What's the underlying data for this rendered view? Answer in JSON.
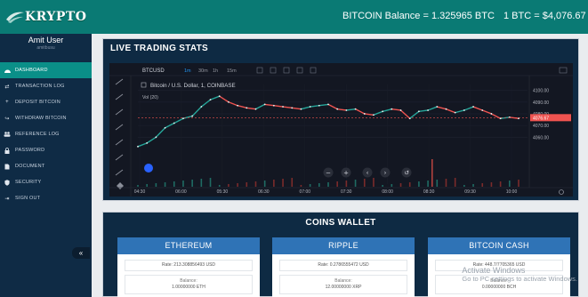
{
  "topbar": {
    "logo_text": "KRYPTO",
    "btc_balance": "BITCOIN Balance = 1.325965 BTC",
    "btc_rate": "1 BTC = $4,076.67"
  },
  "user": {
    "name": "Amit User",
    "id": "amitbusu"
  },
  "sidebar": {
    "items": [
      {
        "label": "DASHBOARD",
        "icon": "dashboard-icon"
      },
      {
        "label": "TRANSACTION LOG",
        "icon": "exchange-icon"
      },
      {
        "label": "DEPOSIT BITCOIN",
        "icon": "plus-icon"
      },
      {
        "label": "WITHDRAW BITCOIN",
        "icon": "share-icon"
      },
      {
        "label": "REFERENCE LOG",
        "icon": "users-icon"
      },
      {
        "label": "PASSWORD",
        "icon": "lock-icon"
      },
      {
        "label": "DOCUMENT",
        "icon": "document-icon"
      },
      {
        "label": "SECURITY",
        "icon": "shield-icon"
      },
      {
        "label": "SIGN OUT",
        "icon": "sign-out-icon"
      }
    ],
    "collapse_glyph": "«"
  },
  "live": {
    "title": "LIVE TRADING STATS",
    "symbol": "BTCUSD",
    "intervals": [
      "1m",
      "30m",
      "1h",
      "15m"
    ],
    "legend": "Bitcoin / U.S. Dollar, 1, COINBASE",
    "volume_label": "Vol (20)"
  },
  "chart_data": {
    "type": "line",
    "title": "Bitcoin / U.S. Dollar, 1, COINBASE",
    "xlabel": "",
    "ylabel": "",
    "x": [
      "04:30",
      "06:00",
      "05:30",
      "06:30",
      "07:00",
      "07:30",
      "08:00",
      "08:30",
      "09:30",
      "10:00"
    ],
    "ylim": [
      4020,
      4105
    ],
    "yticks": [
      "4100.00",
      "4090.00",
      "4080.00",
      "4076.67",
      "4070.00",
      "4060.00"
    ],
    "last_price": "4076.67",
    "series": [
      {
        "values": [
          4052,
          4055,
          4060,
          4068,
          4072,
          4076,
          4078,
          4086,
          4092,
          4095,
          4090,
          4087,
          4085,
          4084,
          4088,
          4087,
          4086,
          4085,
          4084,
          4086,
          4087,
          4088,
          4084,
          4083,
          4084,
          4080,
          4079,
          4082,
          4084,
          4083,
          4076,
          4082,
          4083,
          4086,
          4084,
          4081,
          4083,
          4086,
          4083,
          4080,
          4076,
          4077,
          4076
        ]
      }
    ],
    "grid": true
  },
  "wallet": {
    "title": "COINS WALLET",
    "coins": [
      {
        "name": "ETHEREUM",
        "rate": "Rate: 213.308856493 USD",
        "balance_label": "Balance:",
        "balance": "1.00000000 ETH"
      },
      {
        "name": "RIPPLE",
        "rate": "Rate: 0.2786555472 USD",
        "balance_label": "Balance:",
        "balance": "12.00000000 XRP"
      },
      {
        "name": "BITCOIN CASH",
        "rate": "Rate: 448.7/7705365 USD",
        "balance_label": "Balance:",
        "balance": "0.00000000 BCH"
      }
    ]
  },
  "watermark": {
    "line1": "Activate Windows",
    "line2": "Go to PC settings to activate Windows."
  },
  "colors": {
    "topbar": "#0a7a74",
    "sidebar": "#0f2b45",
    "active": "#0a8f88",
    "up": "#26a69a",
    "down": "#ef5350",
    "coin_head": "#2f73b6"
  }
}
